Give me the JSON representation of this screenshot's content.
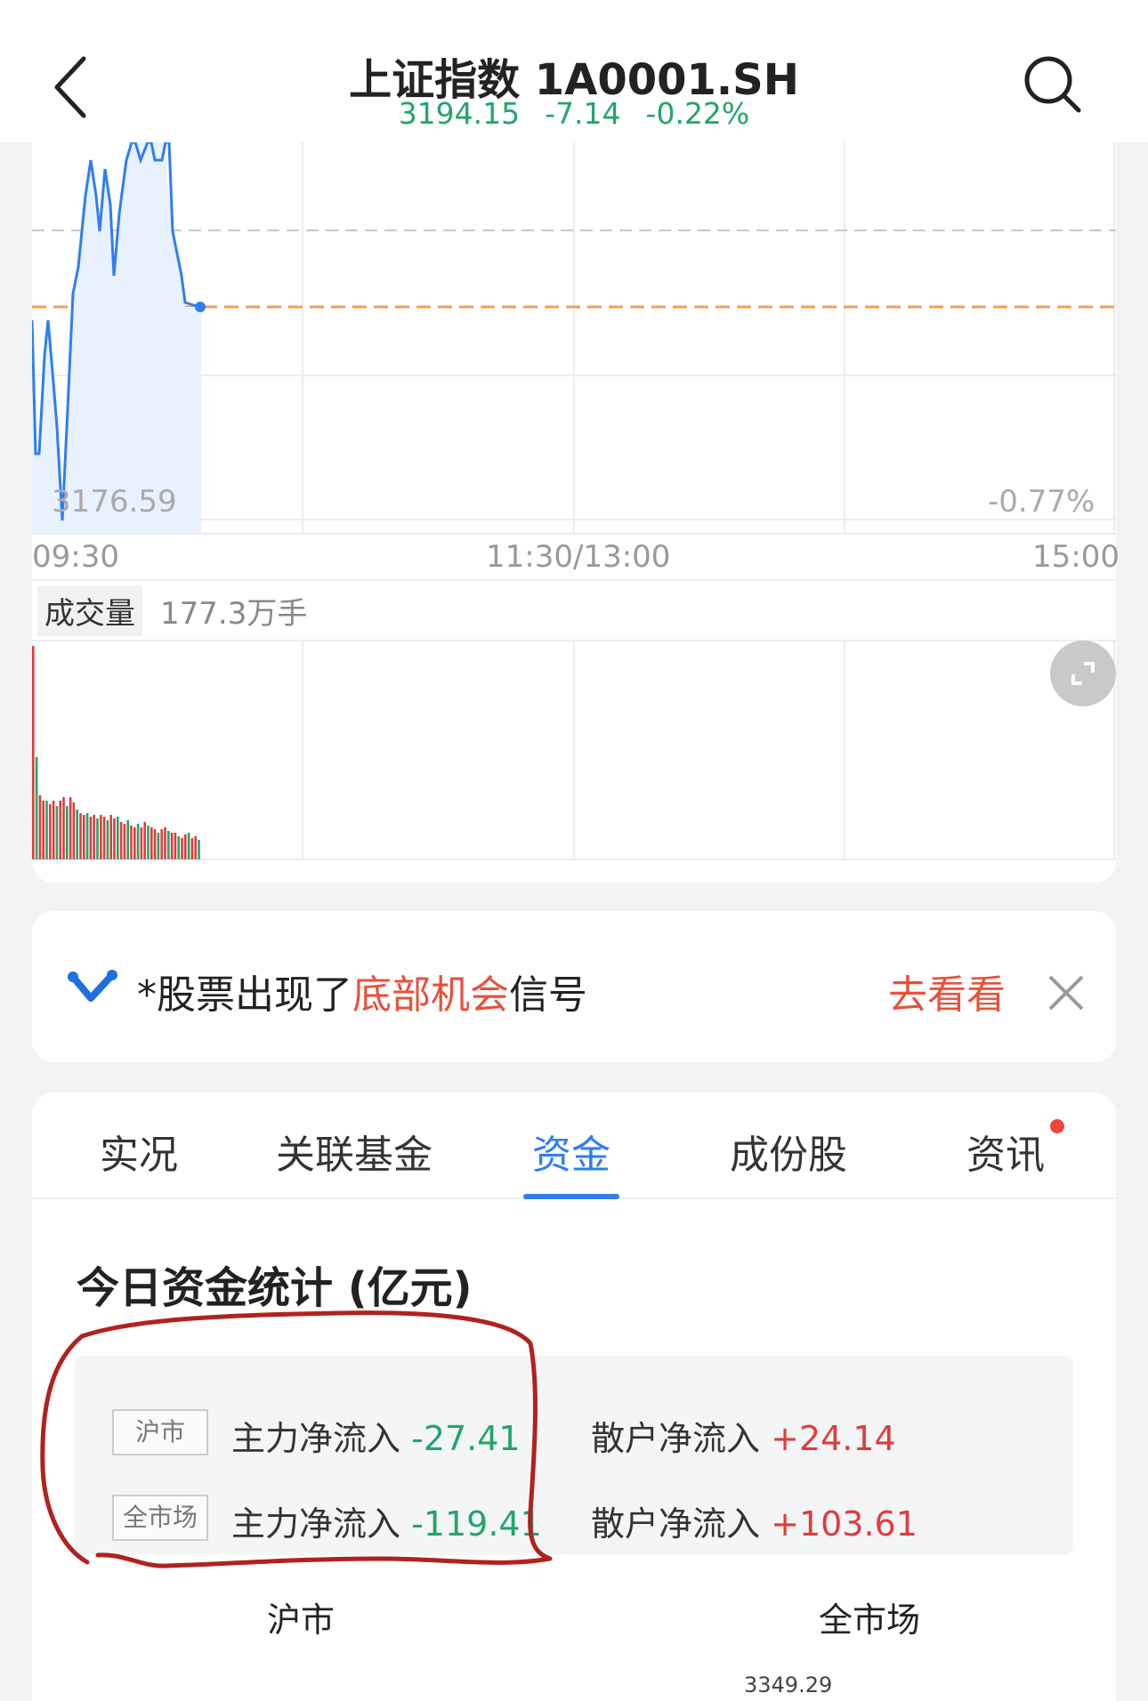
{
  "header": {
    "title": "上证指数 1A0001.SH",
    "price": "3194.15",
    "change": "-7.14",
    "change_pct": "-0.22%",
    "price_color": "#22a56a"
  },
  "chart": {
    "low_label": "3176.59",
    "low_pct": "-0.77%",
    "time_start": "09:30",
    "time_mid": "11:30/13:00",
    "time_end": "15:00",
    "volume_label": "成交量",
    "volume_value": "177.3万手",
    "line_color": "#2f7ef0",
    "ref_line_color": "#f0a04b"
  },
  "banner": {
    "prefix": "*股票出现了",
    "highlight": "底部机会",
    "suffix": "信号",
    "cta": "去看看",
    "highlight_color": "#e8513a"
  },
  "tabs": [
    {
      "label": "实况",
      "active": false
    },
    {
      "label": "关联基金",
      "active": false
    },
    {
      "label": "资金",
      "active": true
    },
    {
      "label": "成份股",
      "active": false
    },
    {
      "label": "资讯",
      "active": false,
      "badge": true
    }
  ],
  "funds": {
    "title": "今日资金统计 (亿元)",
    "rows": [
      {
        "tag": "沪市",
        "main_label": "主力净流入",
        "main_value": "-27.41",
        "retail_label": "散户净流入",
        "retail_value": "+24.14"
      },
      {
        "tag": "全市场",
        "main_label": "主力净流入",
        "main_value": "-119.41",
        "retail_label": "散户净流入",
        "retail_value": "+103.61"
      }
    ],
    "col_left": "沪市",
    "col_right": "全市场",
    "bottom_value": "3349.29"
  },
  "icons": {
    "back": "chevron-left-icon",
    "search": "search-icon",
    "expand": "expand-icon",
    "close": "close-icon",
    "logo": "brand-v-icon"
  }
}
